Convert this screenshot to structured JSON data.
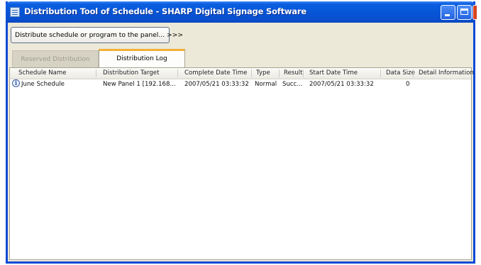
{
  "window": {
    "title": "Distribution Tool of Schedule - SHARP Digital Signage Software",
    "controls": {
      "minimize": "minimize",
      "maximize": "maximize",
      "close": "close"
    }
  },
  "toolbar": {
    "distribute_label": "Distribute schedule or program to the panel... >>>"
  },
  "tabs": [
    {
      "label": "Reserved Distribution",
      "active": false
    },
    {
      "label": "Distribution Log",
      "active": true
    }
  ],
  "table": {
    "columns": [
      "Schedule Name",
      "Distribution Target",
      "Complete Date Time",
      "Type",
      "Result",
      "Start Date Time",
      "Data Size",
      "Detail Information"
    ],
    "rows": [
      {
        "icon": "info-icon",
        "schedule_name": "June Schedule",
        "distribution_target": "New Panel 1 [192.168...",
        "complete_date_time": "2007/05/21 03:33:32",
        "type": "Normal",
        "result": "Succ...",
        "start_date_time": "2007/05/21 03:33:32",
        "data_size": "0",
        "detail_information": ""
      }
    ]
  },
  "colors": {
    "titlebar": "#0754d6",
    "window_bg": "#ece9d8",
    "active_tab_accent": "#f2b035"
  }
}
